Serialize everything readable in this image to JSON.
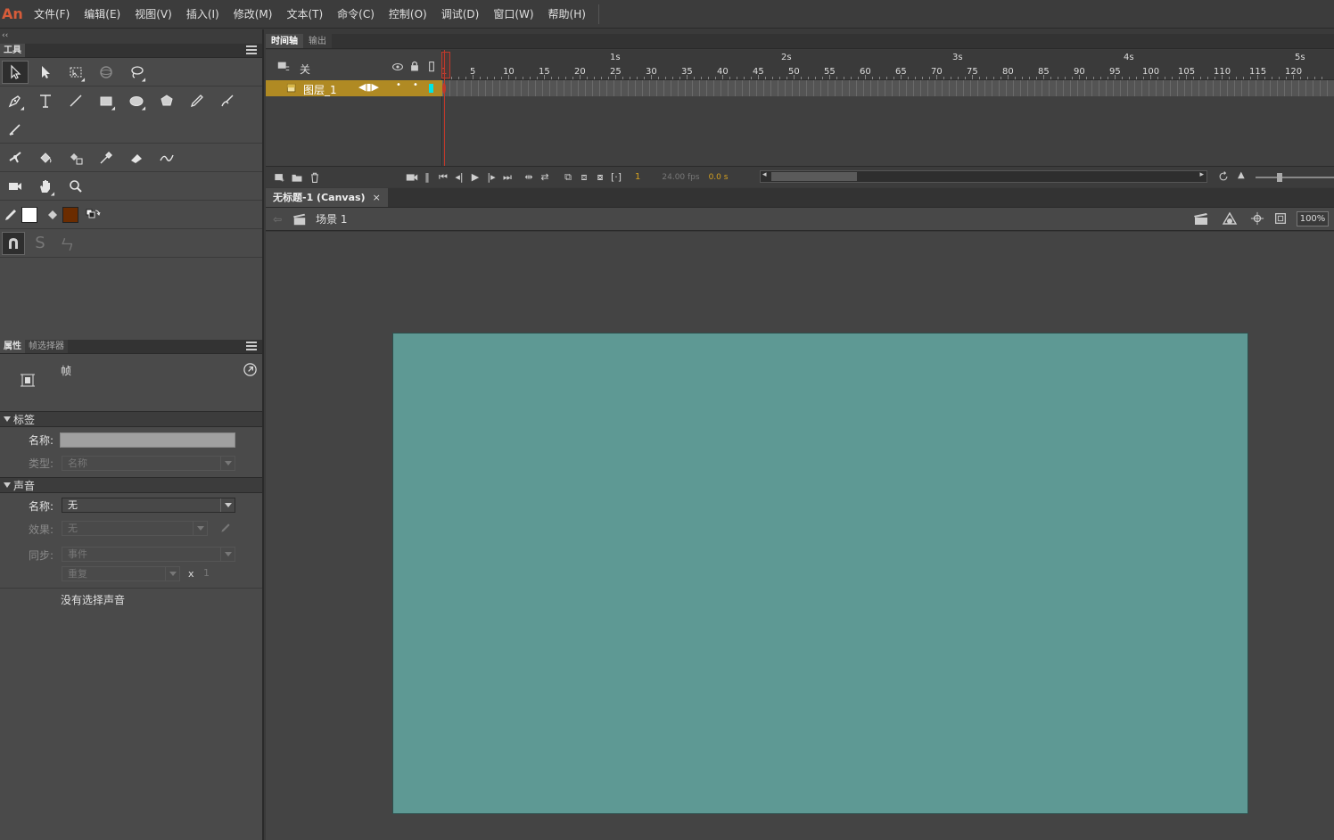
{
  "app": {
    "logo": "An"
  },
  "menu": [
    "文件(F)",
    "编辑(E)",
    "视图(V)",
    "插入(I)",
    "修改(M)",
    "文本(T)",
    "命令(C)",
    "控制(O)",
    "调试(D)",
    "窗口(W)",
    "帮助(H)"
  ],
  "tools_panel": {
    "collapse_glyph": "‹‹",
    "title": "工具",
    "fill_color": "#ffffff",
    "stroke_color": "#6b2c00"
  },
  "properties_panel": {
    "tabs": [
      "属性",
      "帧选择器"
    ],
    "kind": "帧",
    "label_section": {
      "title": "标签",
      "name_label": "名称:",
      "name_value": "",
      "type_label": "类型:",
      "type_value": "名称"
    },
    "sound_section": {
      "title": "声音",
      "name_label": "名称:",
      "name_value": "无",
      "effect_label": "效果:",
      "effect_value": "无",
      "sync_label": "同步:",
      "sync_value": "事件",
      "repeat_value": "重复",
      "repeat_x": "x",
      "repeat_count": "1",
      "no_sound_text": "没有选择声音"
    }
  },
  "timeline": {
    "tabs": [
      "时间轴",
      "输出"
    ],
    "header_label": "关",
    "layer_name": "图层_1",
    "seconds": [
      "1s",
      "2s",
      "3s",
      "4s",
      "5s"
    ],
    "frame_numbers": [
      "1",
      "5",
      "10",
      "15",
      "20",
      "25",
      "30",
      "35",
      "40",
      "45",
      "50",
      "55",
      "60",
      "65",
      "70",
      "75",
      "80",
      "85",
      "90",
      "95",
      "100",
      "105",
      "110",
      "115",
      "120"
    ],
    "current_frame": "1",
    "fps": "24.00 fps",
    "time": "0.0 s"
  },
  "document": {
    "tab_title": "无标题-1 (Canvas)",
    "close_glyph": "×",
    "scene_label": "场景 1",
    "zoom": "100%",
    "stage_color": "#5e9994"
  }
}
